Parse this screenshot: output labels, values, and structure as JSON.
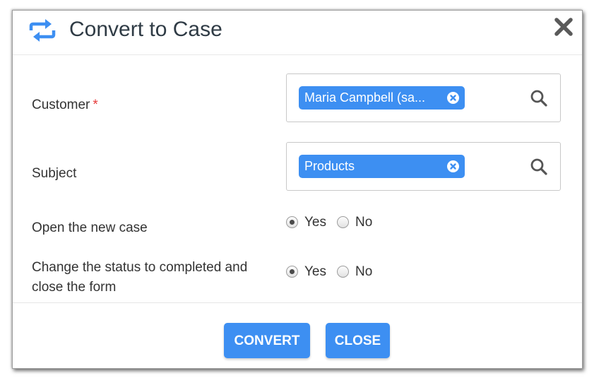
{
  "dialog": {
    "title": "Convert to Case",
    "title_icon": "convert-arrows-icon",
    "close_icon": "close-icon"
  },
  "form": {
    "customer": {
      "label": "Customer",
      "required_mark": "*",
      "value": "Maria Campbell (sa...",
      "remove_icon": "remove-icon",
      "search_icon": "search-icon"
    },
    "subject": {
      "label": "Subject",
      "value": "Products",
      "remove_icon": "remove-icon",
      "search_icon": "search-icon"
    },
    "open_new_case": {
      "label": "Open the new case",
      "options": [
        "Yes",
        "No"
      ],
      "selected": "Yes"
    },
    "change_status": {
      "label_line1": "Change the status to completed and",
      "label_line2": "close the form",
      "options": [
        "Yes",
        "No"
      ],
      "selected": "Yes"
    }
  },
  "buttons": {
    "convert": "CONVERT",
    "close": "CLOSE"
  },
  "colors": {
    "accent": "#3d8ff2",
    "required": "#e63b3b",
    "text": "#333333"
  }
}
